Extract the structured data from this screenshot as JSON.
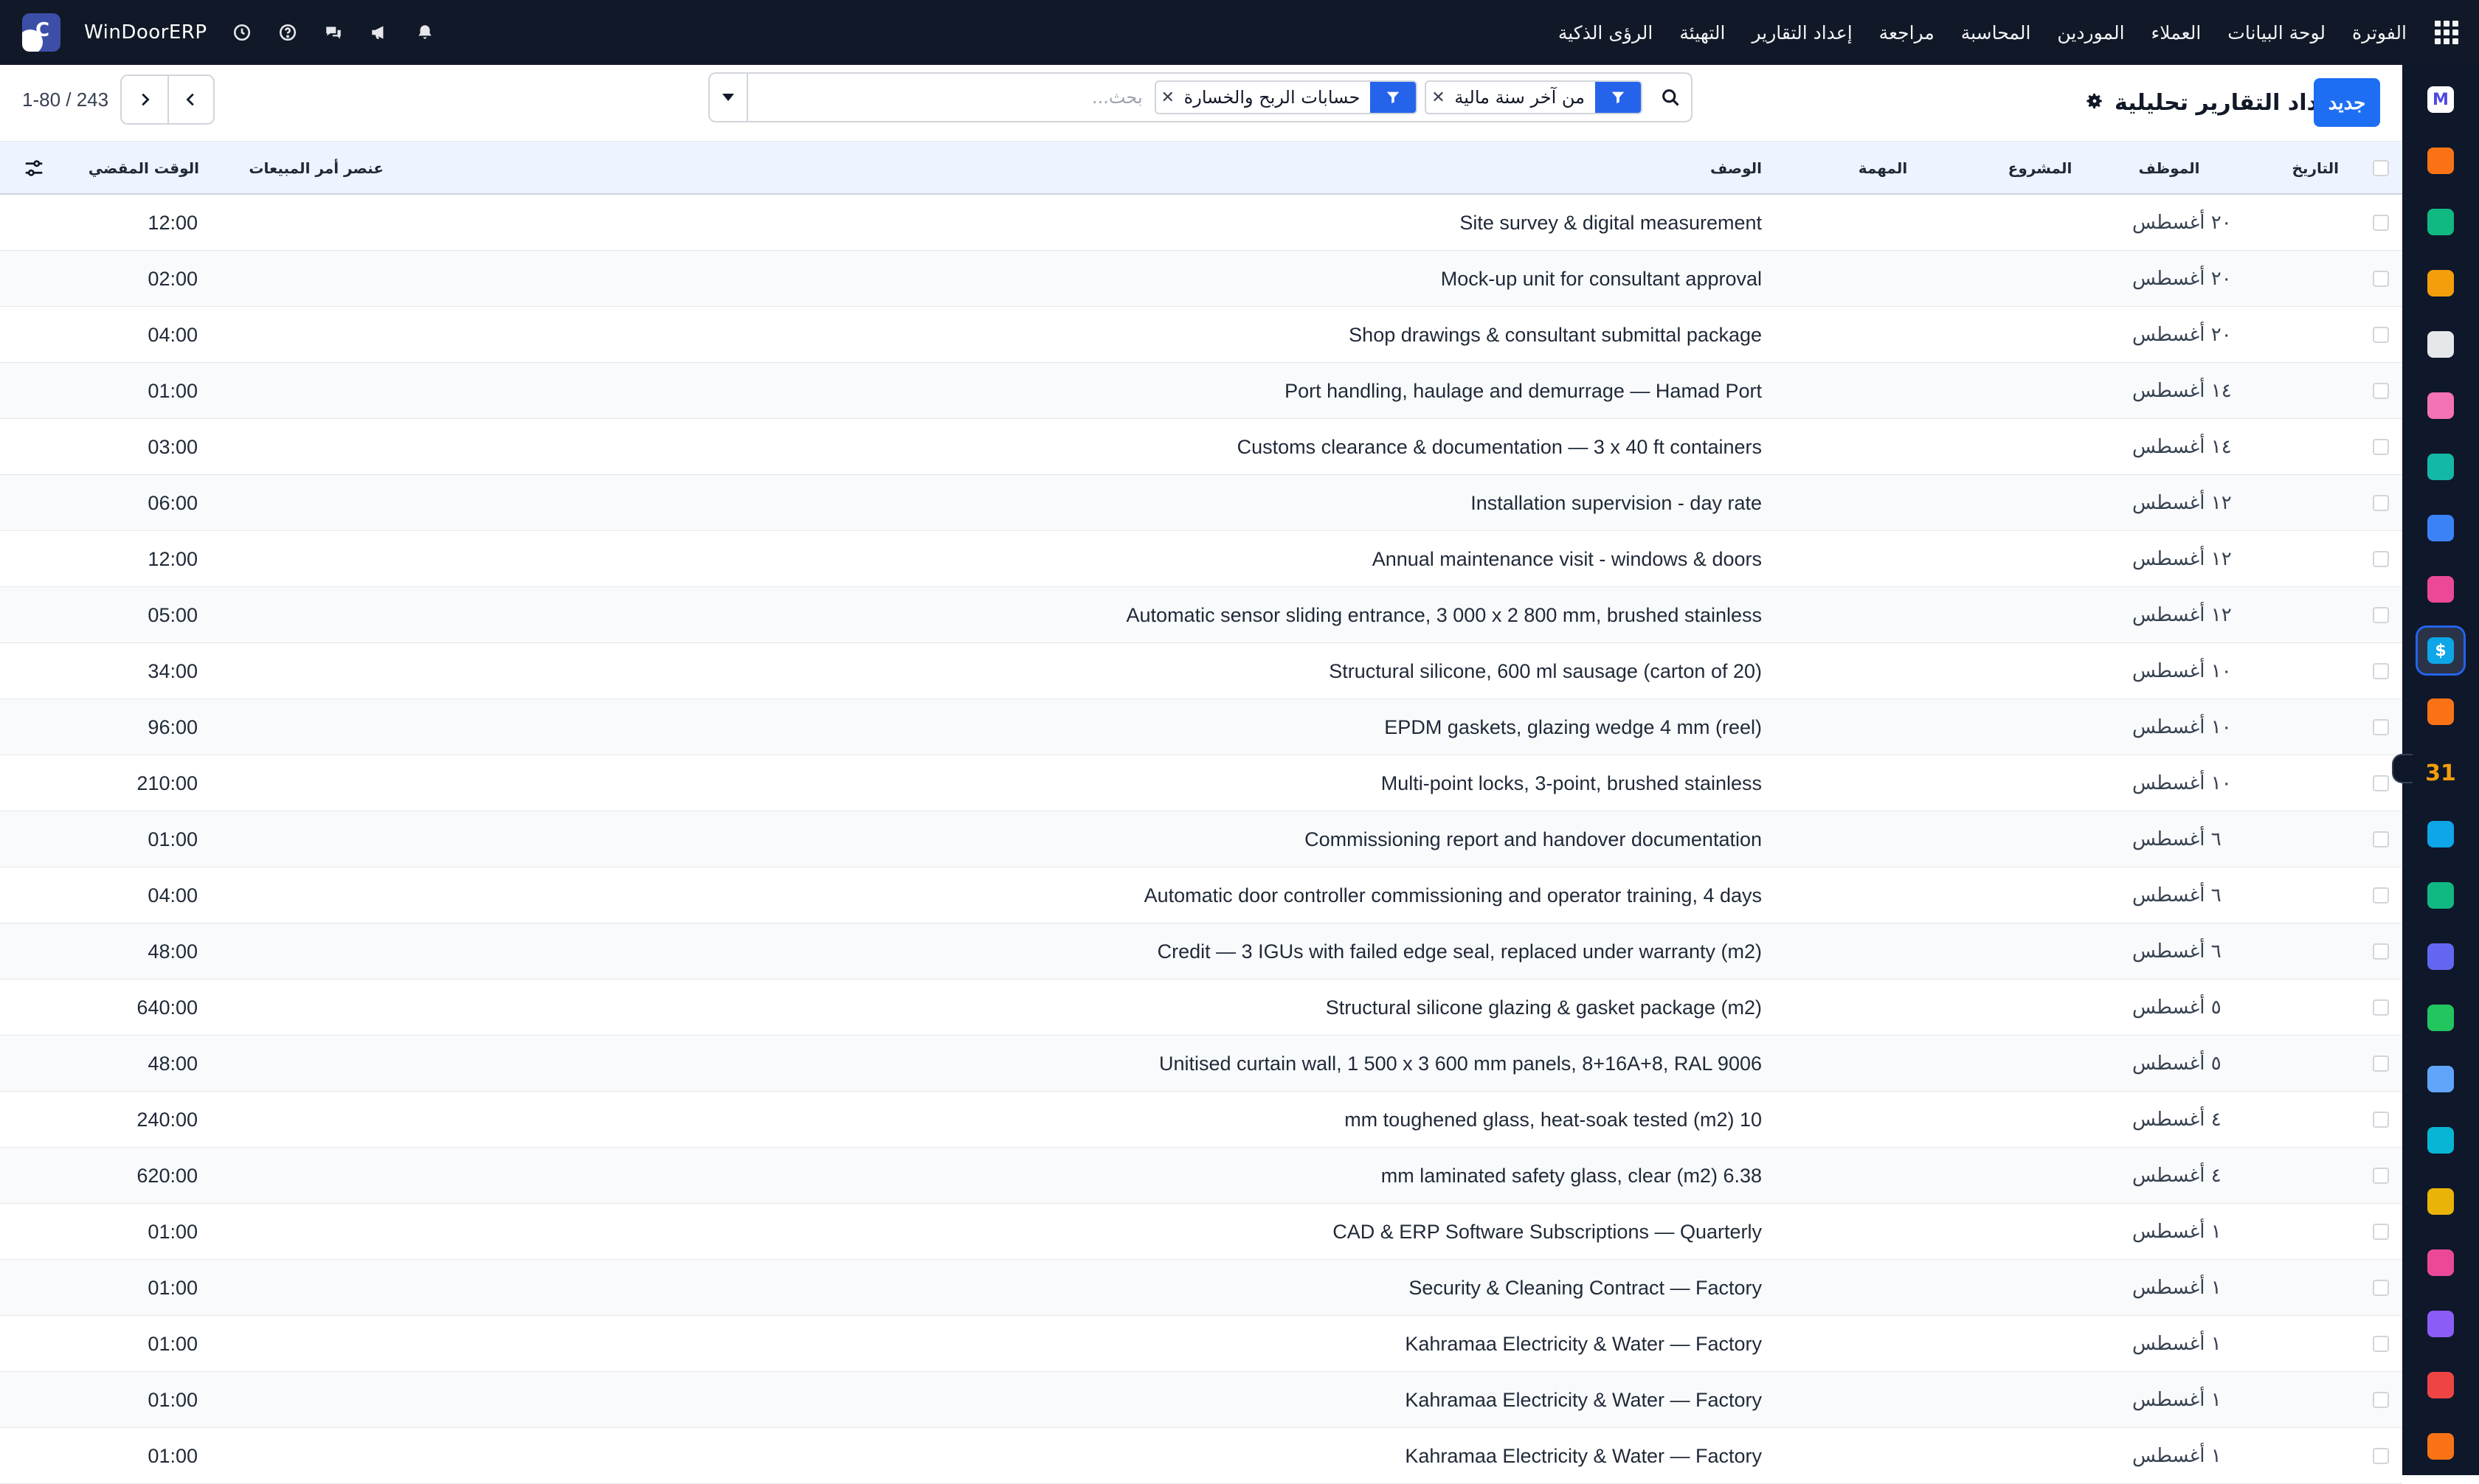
{
  "navbar": {
    "brand": "WinDoorERP",
    "menu": [
      "الفوترة",
      "لوحة البيانات",
      "العملاء",
      "الموردين",
      "المحاسبة",
      "مراجعة",
      "إعداد التقارير",
      "التهيئة",
      "الرؤى الذكية"
    ],
    "icons": [
      "apps-grid-icon",
      "clock-icon",
      "help-icon",
      "chat-icon",
      "megaphone-icon",
      "bell-icon"
    ]
  },
  "control_panel": {
    "new_button": "جديد",
    "title": "إعداد التقارير تحليلية",
    "search": {
      "placeholder": "بحث...",
      "value": "",
      "facets": [
        {
          "label": "من آخر سنة مالية",
          "icon": "filter-icon"
        },
        {
          "label": "حسابات الربح والخسارة",
          "icon": "filter-icon"
        }
      ]
    },
    "pager": {
      "value": "1-80",
      "total": "243",
      "display": "1-80 / 243"
    }
  },
  "table": {
    "columns": {
      "date": "التاريخ",
      "employee": "الموظف",
      "project": "المشروع",
      "task": "المهمة",
      "description": "الوصف",
      "sales_order_item": "عنصر أمر المبيعات",
      "time_spent": "الوقت المقضي"
    },
    "rows": [
      {
        "date": "٢٠ أغسطس",
        "description": "Site survey & digital measurement",
        "time": "12:00"
      },
      {
        "date": "٢٠ أغسطس",
        "description": "Mock-up unit for consultant approval",
        "time": "02:00"
      },
      {
        "date": "٢٠ أغسطس",
        "description": "Shop drawings & consultant submittal package",
        "time": "04:00"
      },
      {
        "date": "١٤ أغسطس",
        "description": "Port handling, haulage and demurrage — Hamad Port",
        "time": "01:00"
      },
      {
        "date": "١٤ أغسطس",
        "description": "Customs clearance & documentation — 3 x 40 ft containers",
        "time": "03:00"
      },
      {
        "date": "١٢ أغسطس",
        "description": "Installation supervision - day rate",
        "time": "06:00"
      },
      {
        "date": "١٢ أغسطس",
        "description": "Annual maintenance visit - windows & doors",
        "time": "12:00"
      },
      {
        "date": "١٢ أغسطس",
        "description": "Automatic sensor sliding entrance, 3 000 x 2 800 mm, brushed stainless",
        "time": "05:00"
      },
      {
        "date": "١٠ أغسطس",
        "description": "Structural silicone, 600 ml sausage (carton of 20)",
        "time": "34:00"
      },
      {
        "date": "١٠ أغسطس",
        "description": "EPDM gaskets, glazing wedge 4 mm (reel)",
        "time": "96:00"
      },
      {
        "date": "١٠ أغسطس",
        "description": "Multi-point locks, 3-point, brushed stainless",
        "time": "210:00"
      },
      {
        "date": "٦ أغسطس",
        "description": "Commissioning report and handover documentation",
        "time": "01:00"
      },
      {
        "date": "٦ أغسطس",
        "description": "Automatic door controller commissioning and operator training, 4 days",
        "time": "04:00"
      },
      {
        "date": "٦ أغسطس",
        "description": "Credit — 3 IGUs with failed edge seal, replaced under warranty (m2)",
        "time": "48:00"
      },
      {
        "date": "٥ أغسطس",
        "description": "Structural silicone glazing & gasket package (m2)",
        "time": "640:00"
      },
      {
        "date": "٥ أغسطس",
        "description": "Unitised curtain wall, 1 500 x 3 600 mm panels, 8+16A+8, RAL 9006",
        "time": "48:00"
      },
      {
        "date": "٤ أغسطس",
        "description": "mm toughened glass, heat-soak tested (m2) 10",
        "time": "240:00"
      },
      {
        "date": "٤ أغسطس",
        "description": "mm laminated safety glass, clear (m2) 6.38",
        "time": "620:00"
      },
      {
        "date": "١ أغسطس",
        "description": "CAD & ERP Software Subscriptions — Quarterly",
        "time": "01:00"
      },
      {
        "date": "١ أغسطس",
        "description": "Security & Cleaning Contract — Factory",
        "time": "01:00"
      },
      {
        "date": "١ أغسطس",
        "description": "Kahramaa Electricity & Water — Factory",
        "time": "01:00"
      },
      {
        "date": "١ أغسطس",
        "description": "Kahramaa Electricity & Water — Factory",
        "time": "01:00"
      },
      {
        "date": "١ أغسطس",
        "description": "Kahramaa Electricity & Water — Factory",
        "time": "01:00"
      }
    ]
  },
  "app_sidebar": {
    "apps": [
      {
        "name": "mail-app-icon",
        "color": "#4f46e5",
        "glyph": "M"
      },
      {
        "name": "chat-app-icon",
        "color": "#f97316",
        "glyph": ""
      },
      {
        "name": "diamond-app-icon",
        "color": "#10b981",
        "glyph": ""
      },
      {
        "name": "chart-app-icon",
        "color": "#f59e0b",
        "glyph": ""
      },
      {
        "name": "box-app-icon",
        "color": "#e5e7eb",
        "glyph": ""
      },
      {
        "name": "photo-app-icon",
        "color": "#f472b6",
        "glyph": ""
      },
      {
        "name": "check-app-icon",
        "color": "#14b8a6",
        "glyph": ""
      },
      {
        "name": "book-app-icon",
        "color": "#3b82f6",
        "glyph": ""
      },
      {
        "name": "cube-app-icon",
        "color": "#ec4899",
        "glyph": ""
      },
      {
        "name": "invoice-app-icon",
        "color": "#0ea5e9",
        "glyph": "$",
        "active": true
      },
      {
        "name": "people-app-icon",
        "color": "#f97316",
        "glyph": ""
      },
      {
        "name": "calendar-app-icon",
        "color": "#f59e0b",
        "glyph": "31"
      },
      {
        "name": "sign-app-icon",
        "color": "#0ea5e9",
        "glyph": ""
      },
      {
        "name": "contacts-app-icon",
        "color": "#10b981",
        "glyph": ""
      },
      {
        "name": "dashboard-app-icon",
        "color": "#6366f1",
        "glyph": ""
      },
      {
        "name": "whatsapp-app-icon",
        "color": "#22c55e",
        "glyph": ""
      },
      {
        "name": "timesheet-app-icon",
        "color": "#60a5fa",
        "glyph": ""
      },
      {
        "name": "wave-app-icon",
        "color": "#06b6d4",
        "glyph": ""
      },
      {
        "name": "send-app-icon",
        "color": "#eab308",
        "glyph": ""
      },
      {
        "name": "bank-app-icon",
        "color": "#ec4899",
        "glyph": ""
      },
      {
        "name": "hexagon-app-icon",
        "color": "#8b5cf6",
        "glyph": ""
      },
      {
        "name": "pie-app-icon",
        "color": "#ef4444",
        "glyph": ""
      },
      {
        "name": "settings-app-icon",
        "color": "#f97316",
        "glyph": ""
      }
    ]
  },
  "colors": {
    "navbar": "#111827",
    "accent": "#1d6ef2",
    "header_bg": "#eef4ff",
    "sidebar": "#0f172a"
  }
}
